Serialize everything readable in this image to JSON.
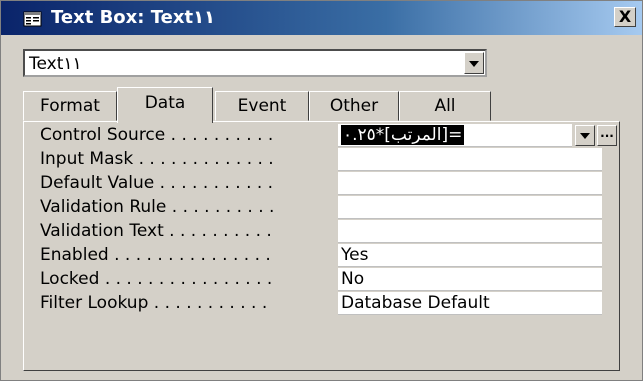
{
  "window": {
    "title": "Text Box: Text١١",
    "close_label": "X"
  },
  "object_selector": {
    "value": "Text١١"
  },
  "tabs": [
    {
      "label": "Format"
    },
    {
      "label": "Data"
    },
    {
      "label": "Event"
    },
    {
      "label": "Other"
    },
    {
      "label": "All"
    }
  ],
  "active_tab": "Data",
  "properties": [
    {
      "label": "Control Source . . . . . . . . . .",
      "value": "=[المرتب]*٠.٢٥"
    },
    {
      "label": "Input Mask . . . . . . . . . . . . .",
      "value": ""
    },
    {
      "label": "Default Value . . . . . . . . . . .",
      "value": ""
    },
    {
      "label": "Validation Rule . . . . . . . . . .",
      "value": ""
    },
    {
      "label": "Validation Text . . . . . . . . . .",
      "value": ""
    },
    {
      "label": "Enabled . . . . . . . . . . . . . . .",
      "value": "Yes"
    },
    {
      "label": "Locked . . . . . . . . . . . . . . . .",
      "value": "No"
    },
    {
      "label": "Filter Lookup . . . . . . . . . . .",
      "value": "Database Default"
    }
  ],
  "builder_button_label": "...",
  "colors": {
    "title_start": "#0a246a",
    "title_end": "#a6caf0",
    "face": "#d4d0c8"
  }
}
